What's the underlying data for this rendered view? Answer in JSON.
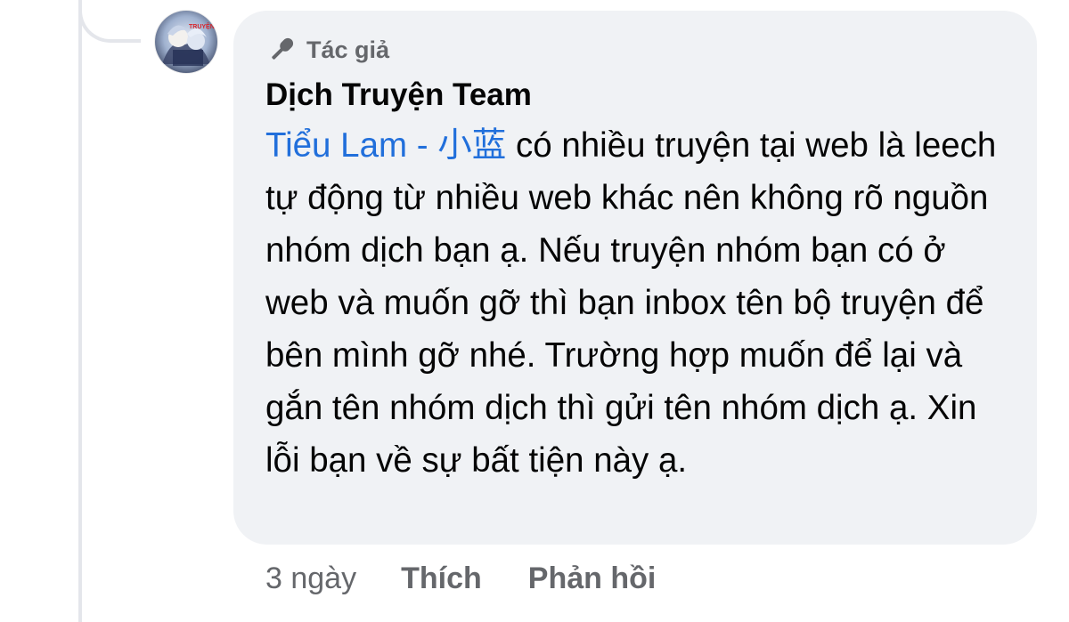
{
  "comment": {
    "badge": {
      "icon": "microphone-icon",
      "label": "Tác giả"
    },
    "author": "Dịch Truyện Team",
    "mention": "Tiểu Lam - 小蓝",
    "text": " có nhiều truyện tại web là leech tự động từ nhiều web khác nên không rõ nguồn nhóm dịch bạn ạ. Nếu truyện nhóm bạn có ở web và muốn gỡ thì bạn inbox tên bộ truyện để bên mình gỡ nhé. Trường hợp muốn để lại và gắn tên nhóm dịch thì gửi tên nhóm dịch ạ. Xin lỗi bạn về sự bất tiện này ạ.",
    "avatar_text": "TRUYỆN"
  },
  "footer": {
    "time": "3 ngày",
    "like": "Thích",
    "reply": "Phản hồi"
  },
  "colors": {
    "bubble": "#f0f2f5",
    "mention": "#216fdb",
    "secondary_text": "#65676b",
    "primary_text": "#050505"
  }
}
